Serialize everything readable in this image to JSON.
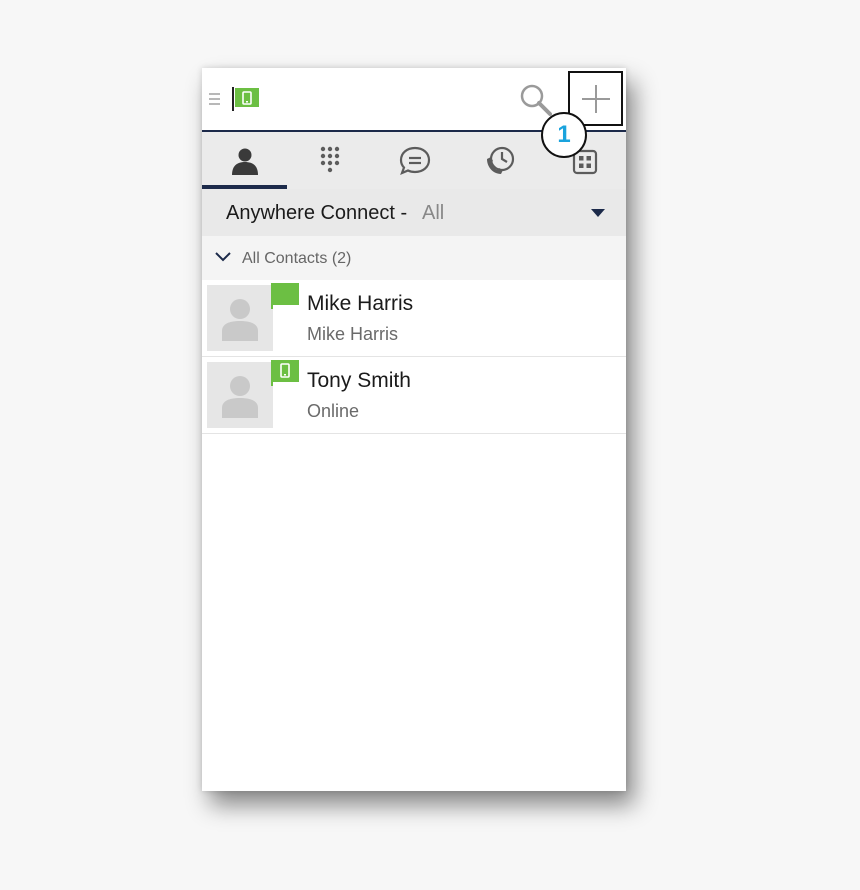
{
  "colors": {
    "accent_navy": "#1c2a4a",
    "presence_green": "#6cbf43",
    "callout_blue": "#1aa3dd"
  },
  "appbar": {
    "menu_icon": "hamburger-menu-icon",
    "status_icon": "green-flag-mobile-icon",
    "search_icon": "search-icon",
    "add_icon": "plus-icon",
    "callout_number": "1"
  },
  "tabs": [
    {
      "icon": "person-icon",
      "active": true
    },
    {
      "icon": "dialpad-icon",
      "active": false
    },
    {
      "icon": "chat-bubble-icon",
      "active": false
    },
    {
      "icon": "call-history-icon",
      "active": false
    },
    {
      "icon": "apps-grid-icon",
      "active": false
    }
  ],
  "filter": {
    "label": "Anywhere Connect -",
    "value": "All"
  },
  "group": {
    "title": "All Contacts (2)"
  },
  "contacts": [
    {
      "name": "Mike Harris",
      "subtitle": "Mike Harris",
      "presence_icon": "green-flag-icon"
    },
    {
      "name": "Tony Smith",
      "subtitle": "Online",
      "presence_icon": "green-flag-mobile-icon"
    }
  ]
}
